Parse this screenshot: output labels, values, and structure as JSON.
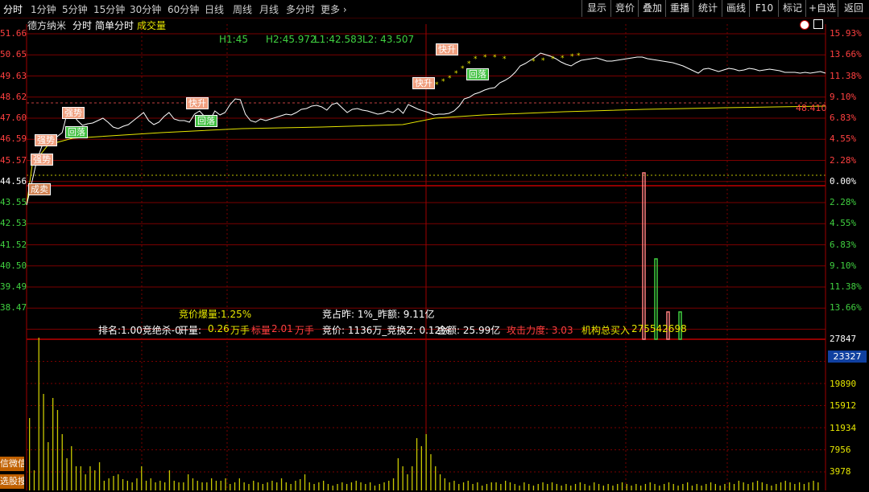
{
  "toolbar": {
    "tabs": [
      "分时",
      "1分钟",
      "5分钟",
      "15分钟",
      "30分钟",
      "60分钟",
      "日线",
      "周线",
      "月线",
      "多分时",
      "更多 ›"
    ],
    "right_buttons": [
      "显示",
      "竞价",
      "叠加",
      "重播",
      "统计",
      "画线",
      "F10",
      "标记",
      "+自选",
      "返回"
    ]
  },
  "subheader": {
    "stock_name": "德方纳米",
    "mode1": "分时",
    "mode2": "简单分时",
    "mode3": "成交量",
    "h1": "H1:45",
    "h2": "H2:45.972",
    "l1": "L1:42.583",
    "l2": "L2: 43.507"
  },
  "price_axis_left": [
    "51.66",
    "50.65",
    "49.63",
    "48.62",
    "47.60",
    "46.59",
    "45.57",
    "44.56",
    "43.55",
    "42.53",
    "41.52",
    "40.50",
    "39.49",
    "38.47"
  ],
  "percent_axis_right": [
    "15.93%",
    "13.66%",
    "11.38%",
    "9.10%",
    "6.83%",
    "4.55%",
    "2.28%",
    "0.00%",
    "2.28%",
    "4.55%",
    "6.83%",
    "9.10%",
    "11.38%",
    "13.66%"
  ],
  "ref_price_label": "48.410",
  "volume_axis_right": [
    "27847",
    "23327",
    "19890",
    "15912",
    "11934",
    "7956",
    "3978"
  ],
  "tags": {
    "strong1": "强势",
    "strong2": "强势",
    "strong3": "强势",
    "pullback1": "回落",
    "pullback2": "回落",
    "pullback3": "回落",
    "fast_rise1": "快升",
    "fast_rise2": "快升",
    "fast_rise3": "快升",
    "open_sell": "成卖"
  },
  "stats": {
    "auction_burst": "竞价爆量:1.25%",
    "auction_ratio": "竞占昨: 1%_昨额: 9.11亿",
    "rank": "排名:1.00竞绝杀-0.",
    "open_vol_label": "开量:",
    "open_vol_val": "0.26",
    "unit1": "万手",
    "target_label": "标量",
    "target_val": "2.01",
    "unit2": "万手",
    "auction_price": "竞价: 1136万_竞换Z: 0.12%",
    "amount": "金额: 25.99亿",
    "attack": "攻击力度: 3.03",
    "institution": "机构总买入",
    "institution_val": "275542698"
  },
  "side_buttons": [
    "信微信",
    "选股搜"
  ],
  "colors": {
    "up": "#ff4040",
    "down": "#40d040",
    "grid": "#7a0000",
    "price_line": "#ffffff",
    "avg_line": "#e6e600",
    "volume": "#c8c800",
    "blue_badge": "#1040a0"
  }
}
